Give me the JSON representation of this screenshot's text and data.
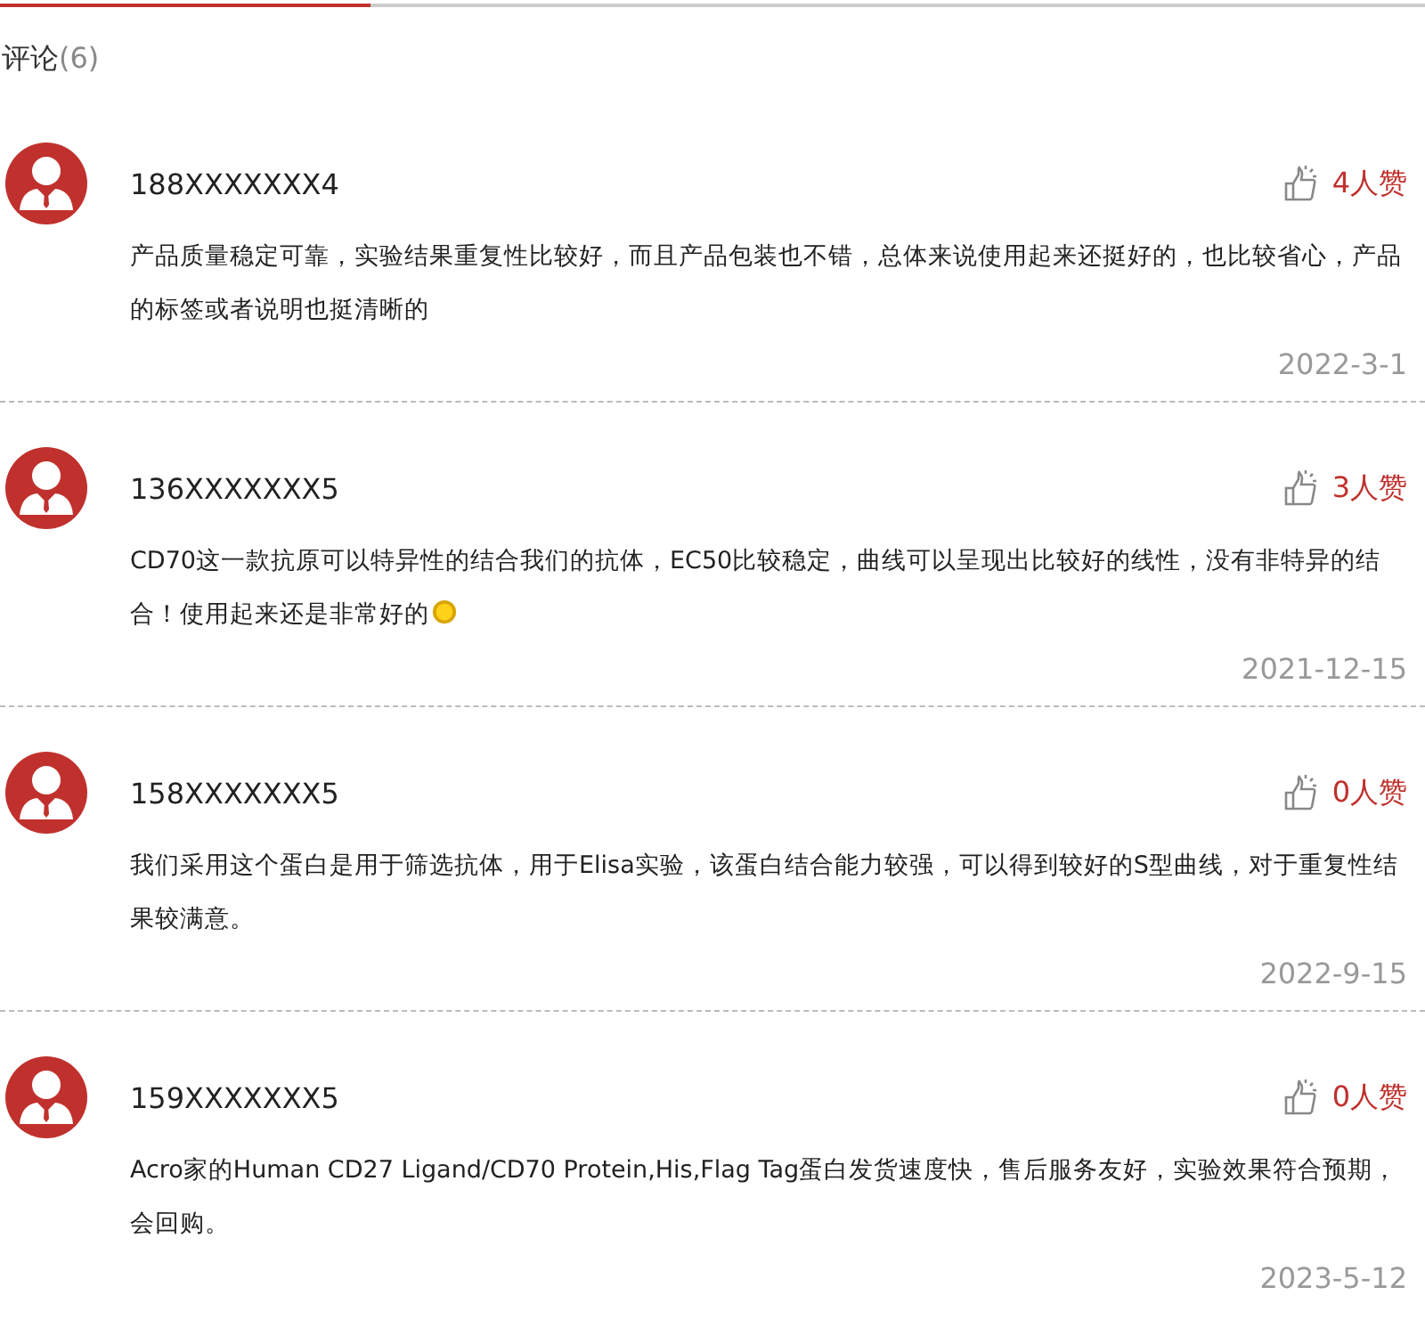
{
  "tab_bar": {
    "level": 0.26
  },
  "header": {
    "title": "评论",
    "count": "(6)"
  },
  "comments": [
    {
      "user": "188XXXXXXX4",
      "likes": "4人赞",
      "text": "产品质量稳定可靠，实验结果重复性比较好，而且产品包装也不错，总体来说使用起来还挺好的，也比较省心，产品的标签或者说明也挺清晰的",
      "emoji": false,
      "date": "2022-3-1"
    },
    {
      "user": "136XXXXXXX5",
      "likes": "3人赞",
      "text": "CD70这一款抗原可以特异性的结合我们的抗体，EC50比较稳定，曲线可以呈现出比较好的线性，没有非特异的结合！使用起来还是非常好的",
      "emoji": true,
      "date": "2021-12-15"
    },
    {
      "user": "158XXXXXXX5",
      "likes": "0人赞",
      "text": "我们采用这个蛋白是用于筛选抗体，用于Elisa实验，该蛋白结合能力较强，可以得到较好的S型曲线，对于重复性结果较满意。",
      "emoji": false,
      "date": "2022-9-15"
    },
    {
      "user": "159XXXXXXX5",
      "likes": "0人赞",
      "text": "Acro家的Human CD27 Ligand/CD70 Protein,His,Flag Tag蛋白发货速度快，售后服务友好，实验效果符合预期，会回购。",
      "emoji": false,
      "date": "2023-5-12"
    }
  ]
}
